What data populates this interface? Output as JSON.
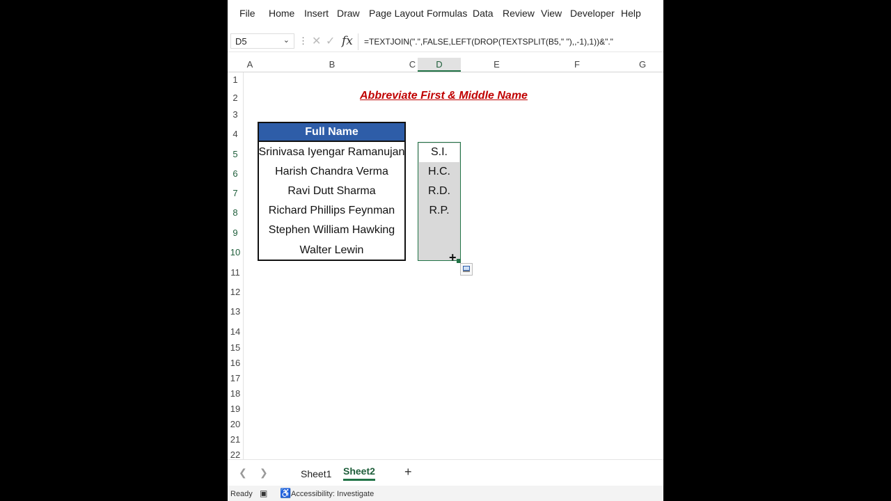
{
  "menu": [
    "File",
    "Home",
    "Insert",
    "Draw",
    "Page Layout",
    "Formulas",
    "Data",
    "Review",
    "View",
    "Developer",
    "Help"
  ],
  "formula_bar": {
    "name_box": "D5",
    "fx_label": "fx",
    "formula": "=TEXTJOIN(\".\",FALSE,LEFT(DROP(TEXTSPLIT(B5,\" \"),,-1),1))&\".\""
  },
  "columns": [
    "A",
    "B",
    "C",
    "D",
    "E",
    "F",
    "G"
  ],
  "rows": [
    "1",
    "2",
    "3",
    "4",
    "5",
    "6",
    "7",
    "8",
    "9",
    "10",
    "11",
    "12",
    "13",
    "14",
    "15",
    "16",
    "17",
    "18",
    "19",
    "20",
    "21",
    "22"
  ],
  "title": "Abbreviate First & Middle Name",
  "table": {
    "header": "Full Name",
    "names": [
      "Srinivasa Iyengar Ramanujan",
      "Harish Chandra Verma",
      "Ravi Dutt Sharma",
      "Richard Phillips Feynman",
      "Stephen William Hawking",
      "Walter Lewin"
    ]
  },
  "results": [
    "S.I.",
    "H.C.",
    "R.D.",
    "R.P."
  ],
  "selection": {
    "active_cell": "D5",
    "range": "D5:D10"
  },
  "sheets": {
    "tabs": [
      "Sheet1",
      "Sheet2"
    ],
    "active": "Sheet2",
    "add": "+"
  },
  "status": {
    "ready": "Ready",
    "accessibility": "Accessibility: Investigate"
  },
  "colors": {
    "accent": "#217346",
    "header_fill": "#2e5da8",
    "title": "#c00000",
    "selection_fill": "#d9d9d9"
  }
}
